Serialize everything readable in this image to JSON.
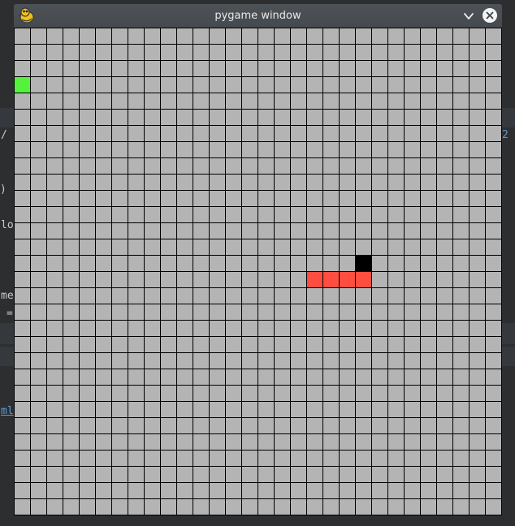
{
  "window": {
    "title": "pygame window",
    "app_icon": "pygame-snake-icon",
    "controls": [
      "minimize-chevron-icon",
      "close-x-icon"
    ]
  },
  "background_fragments": [
    "/",
    "2",
    ")",
    "lo",
    "me",
    "=",
    "ml"
  ],
  "game": {
    "grid": {
      "columns": 30,
      "rows": 30
    },
    "colors": {
      "background": "#b4b4b4",
      "grid_lines": "#000000",
      "food": "#55f23c",
      "snake_body": "#ff4d40",
      "snake_head": "#000000"
    },
    "food": {
      "col": 0,
      "row": 3
    },
    "snake": {
      "head": {
        "col": 21,
        "row": 14
      },
      "body": [
        {
          "col": 21,
          "row": 15
        },
        {
          "col": 20,
          "row": 15
        },
        {
          "col": 19,
          "row": 15
        },
        {
          "col": 18,
          "row": 15
        }
      ]
    }
  }
}
